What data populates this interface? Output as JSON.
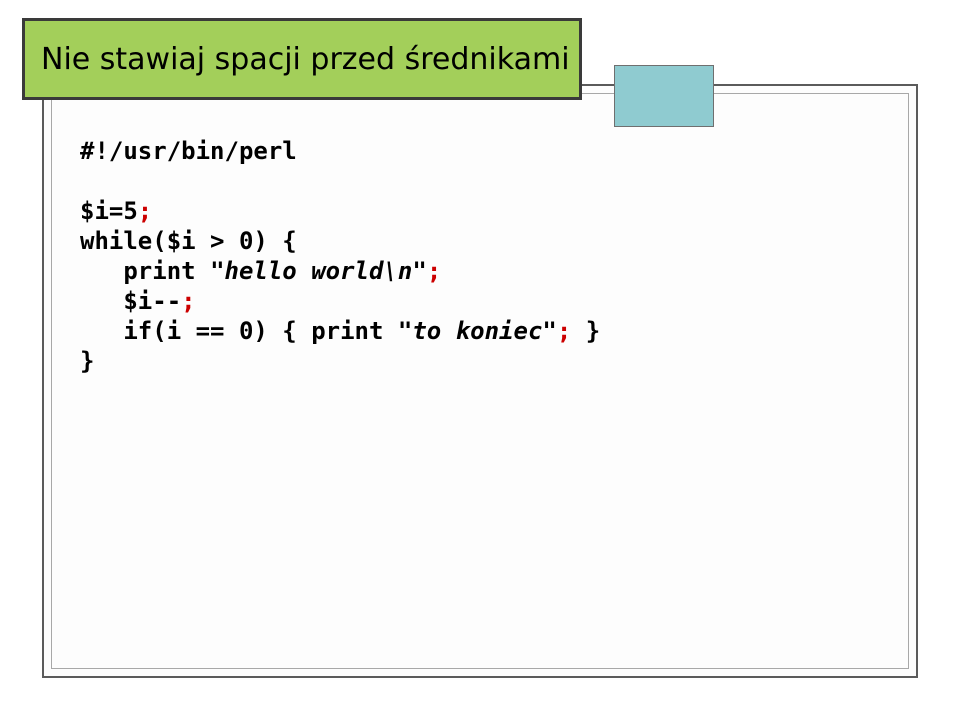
{
  "title": "Nie stawiaj spacji przed średnikami",
  "code": {
    "l1": "#!/usr/bin/perl",
    "l2": "",
    "l3_p1": "$i=5",
    "l3_sc": ";",
    "l4_p1": "while($i > 0) {",
    "l5_pad": "   ",
    "l5_kw": "print ",
    "l5_str": "\"hello world\\n\"",
    "l5_sc": ";",
    "l6_pad": "   ",
    "l6_p1": "$i--",
    "l6_sc": ";",
    "l7_pad": "   ",
    "l7_p1": "if(i == 0) { ",
    "l7_kw": "print ",
    "l7_str": "\"to koniec\"",
    "l7_sc": ";",
    "l7_p2": " }",
    "l8": "}"
  }
}
